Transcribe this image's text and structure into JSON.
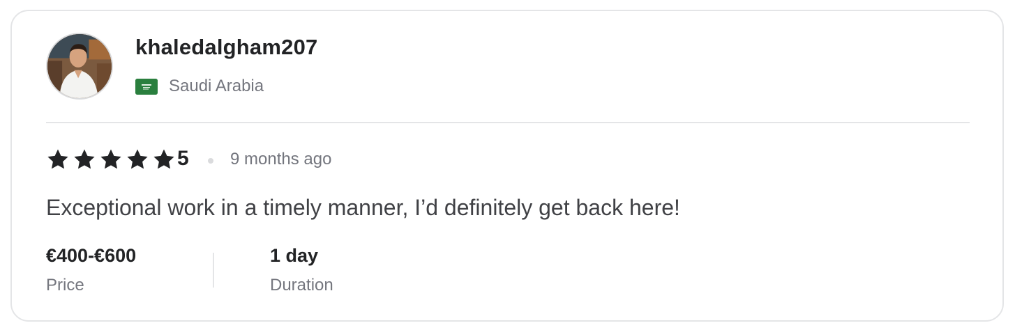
{
  "reviewer": {
    "username": "khaledalgham207",
    "avatar_icon": "user-avatar-photo",
    "country": "Saudi Arabia",
    "flag_icon": "saudi-arabia-flag-icon"
  },
  "review": {
    "rating_value": "5",
    "stars": 5,
    "star_icon": "star-icon",
    "time_ago": "9 months ago",
    "text": "Exceptional work in a timely manner, I’d definitely get back here!"
  },
  "details": {
    "price_value": "€400-€600",
    "price_label": "Price",
    "duration_value": "1 day",
    "duration_label": "Duration"
  },
  "colors": {
    "text_primary": "#222325",
    "text_secondary": "#74767e",
    "border": "#e4e5e7",
    "flag_green": "#2a7f3e"
  }
}
